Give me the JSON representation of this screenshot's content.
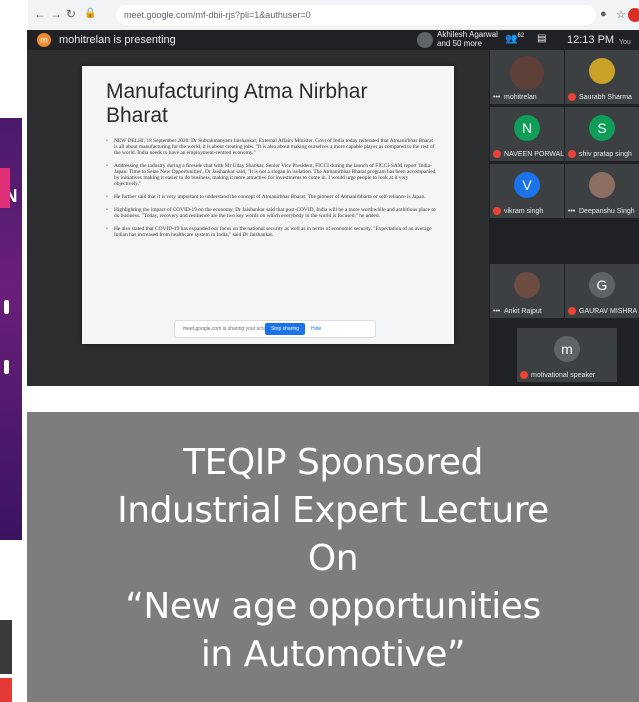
{
  "browser": {
    "url": "meet.google.com/mf-dbii-rjs?pli=1&authuser=0"
  },
  "meet": {
    "presenter_initial": "m",
    "presenter_text": "mohitrelan is presenting",
    "participants_summary_line1": "Akhilesh Agarwal",
    "participants_summary_line2": "and 50 more",
    "participant_count": "62",
    "time": "12:13 PM",
    "you_label": "You"
  },
  "slide": {
    "title": "Manufacturing Atma Nirbhar Bharat",
    "paragraphs": [
      "NEW DELHI, 18 September 2020: Dr Subrahmanyam Jaishankar, External Affairs Minister, Govt of India today reiterated that Atmanirbhar Bharat is all about manufacturing for the world, it is about creating jobs. \"It is also about making ourselves a more capable player as compared to the rest of the world. India needs to have an employment-centred economy.\"",
      "Addressing the industry during a fireside chat with Mr Uday Shankar, Senior Vice President, FICCI during the launch of FICCI-SAM report 'India-Japan: Time to Seize New Opportunities', Dr Jaishankar said, \"It is not a slogan in isolation. The Atmanirbhar Bharat program has been accompanied by initiatives making it easier to do business, making it more attractive for investments to come in. I would urge people to look at it very objectively.\"",
      "He further said that it is very important to understand the concept of Atmanirbhar Bharat. The pioneer of Atmanirbharta or self-reliance is Japan.",
      "Highlighting the impact of COVID-19 on the economy, Dr Jaishankar said that post-COVID, India will be a more worthwhile and ambitious place to do business. \"Today, recovery and resilience are the two key words on which everybody in the world is focused,\" he added.",
      "He also stated that COVID-19 has expanded our focus on the national security as well as in terms of economic security. \"Expectation of an average Indian has increased from healthcare system in India,\" said Dr Jaishankar."
    ],
    "share_text": "meet.google.com is sharing your screen.",
    "stop_label": "Stop sharing",
    "hide_label": "Hide"
  },
  "participants": [
    {
      "name": "mohitrelan",
      "initial": "",
      "color": "#5d4037"
    },
    {
      "name": "Saurabh Sharma",
      "initial": "",
      "color": "#c9a227"
    },
    {
      "name": "NAVEEN PORWAL",
      "initial": "N",
      "color": "#0f9d58"
    },
    {
      "name": "shiv pratap singh",
      "initial": "S",
      "color": "#0f9d58"
    },
    {
      "name": "vikram singh",
      "initial": "V",
      "color": "#1a73e8"
    },
    {
      "name": "Deepanshu Singh",
      "initial": "",
      "color": "#8d6e63"
    },
    {
      "name": "Ankit Rajput",
      "initial": "",
      "color": "#6d4c41"
    },
    {
      "name": "GAURAV MISHRA",
      "initial": "G",
      "color": "#5f6368"
    },
    {
      "name": "motivational speaker",
      "initial": "m",
      "color": "#5f6368"
    }
  ],
  "left_strip": {
    "letter": "N"
  },
  "banner": {
    "line1": "TEQIP Sponsored",
    "line2": "Industrial Expert Lecture",
    "line3": "On",
    "line4": "“New age opportunities",
    "line5": "in Automotive”"
  },
  "colors": {
    "banner_bg": "#7d7d7d",
    "meet_bg": "#202124",
    "accent_blue": "#1a73e8",
    "mic_red": "#ea4335"
  }
}
